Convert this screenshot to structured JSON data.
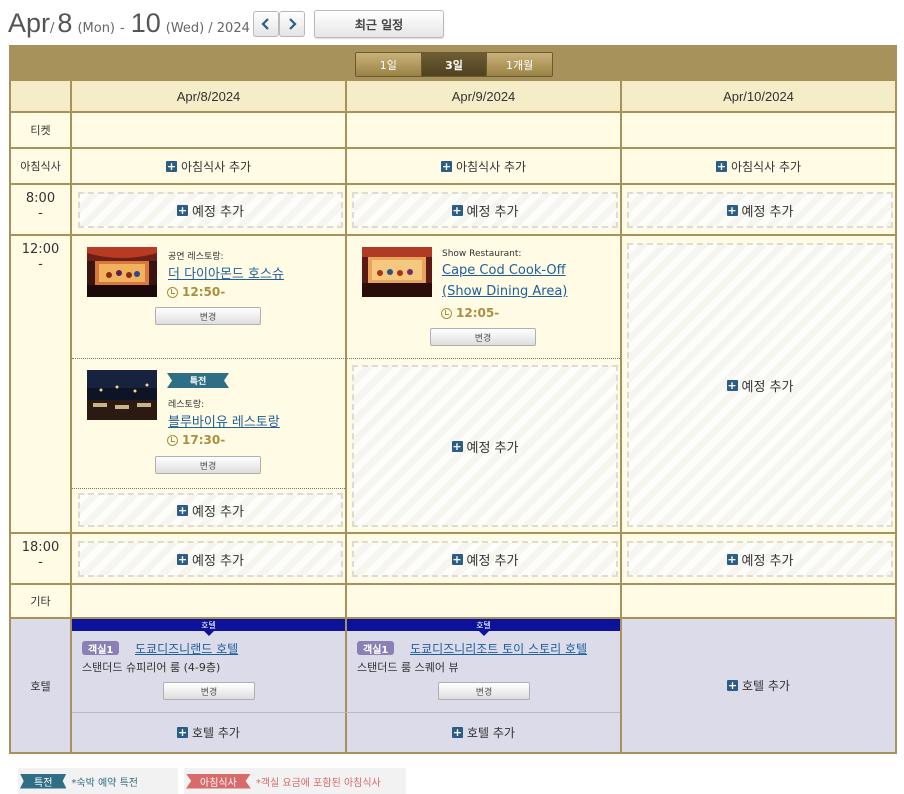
{
  "header": {
    "start_month": "Apr",
    "sep1": "/",
    "start_day": "8",
    "start_dow": "(Mon)",
    "dash": "-",
    "end_day": "10",
    "end_dow": "(Wed)",
    "year_part": "/ 2024",
    "prev_icon": "chevron-left-icon",
    "next_icon": "chevron-right-icon",
    "recent_label": "최근 일정"
  },
  "view_tabs": [
    {
      "label": "1일",
      "active": false
    },
    {
      "label": "3일",
      "active": true
    },
    {
      "label": "1개월",
      "active": false
    }
  ],
  "columns": [
    "Apr/8/2024",
    "Apr/9/2024",
    "Apr/10/2024"
  ],
  "rows": {
    "ticket": "티켓",
    "breakfast": "아침식사",
    "slot1_time": "8:00",
    "slot1_dash": "-",
    "slot2_time": "12:00",
    "slot2_dash": "-",
    "slot3_time": "18:00",
    "slot3_dash": "-",
    "other": "기타",
    "hotel": "호텔"
  },
  "actions": {
    "add_breakfast": "아침식사 추가",
    "add_plan": "예정 추가",
    "add_hotel": "호텔 추가",
    "change": "변경"
  },
  "events": {
    "e1": {
      "type": "공연 레스토랑:",
      "name": "더 다이아몬드 호스슈",
      "time": "12:50-"
    },
    "e2": {
      "type": "Show Restaurant:",
      "name_line1": "Cape Cod Cook-Off",
      "name_line2": "(Show Dining Area)",
      "time": "12:05-"
    },
    "e3": {
      "ribbon": "특전",
      "type": "레스토랑:",
      "name": "블루바이유 레스토랑",
      "time": "17:30-"
    }
  },
  "hotels": {
    "h1": {
      "bar": "호텔",
      "room": "객실1",
      "name": "도쿄디즈니랜드 호텔",
      "room_type": "스탠더드 슈피리어 룸 (4-9층)"
    },
    "h2": {
      "bar": "호텔",
      "room": "객실1",
      "name": "도쿄디즈니리조트 토이 스토리 호텔",
      "room_type": "스탠더드 룸 스퀘어 뷰"
    }
  },
  "legend": {
    "perk_label": "특전",
    "perk_text": "*숙박 예약 특전",
    "breakfast_label": "아침식사",
    "breakfast_text": "*객실 요금에 포함된 아침식사"
  },
  "colors": {
    "frame": "#a8925b",
    "cell": "#fffbe5",
    "hotel_cell": "#dbdbea",
    "link": "#1d5f9c",
    "time": "#a98f3f",
    "ribbon_perk": "#2f6f86",
    "ribbon_breakfast": "#d96a6a",
    "hotel_bar": "#0c129a"
  }
}
